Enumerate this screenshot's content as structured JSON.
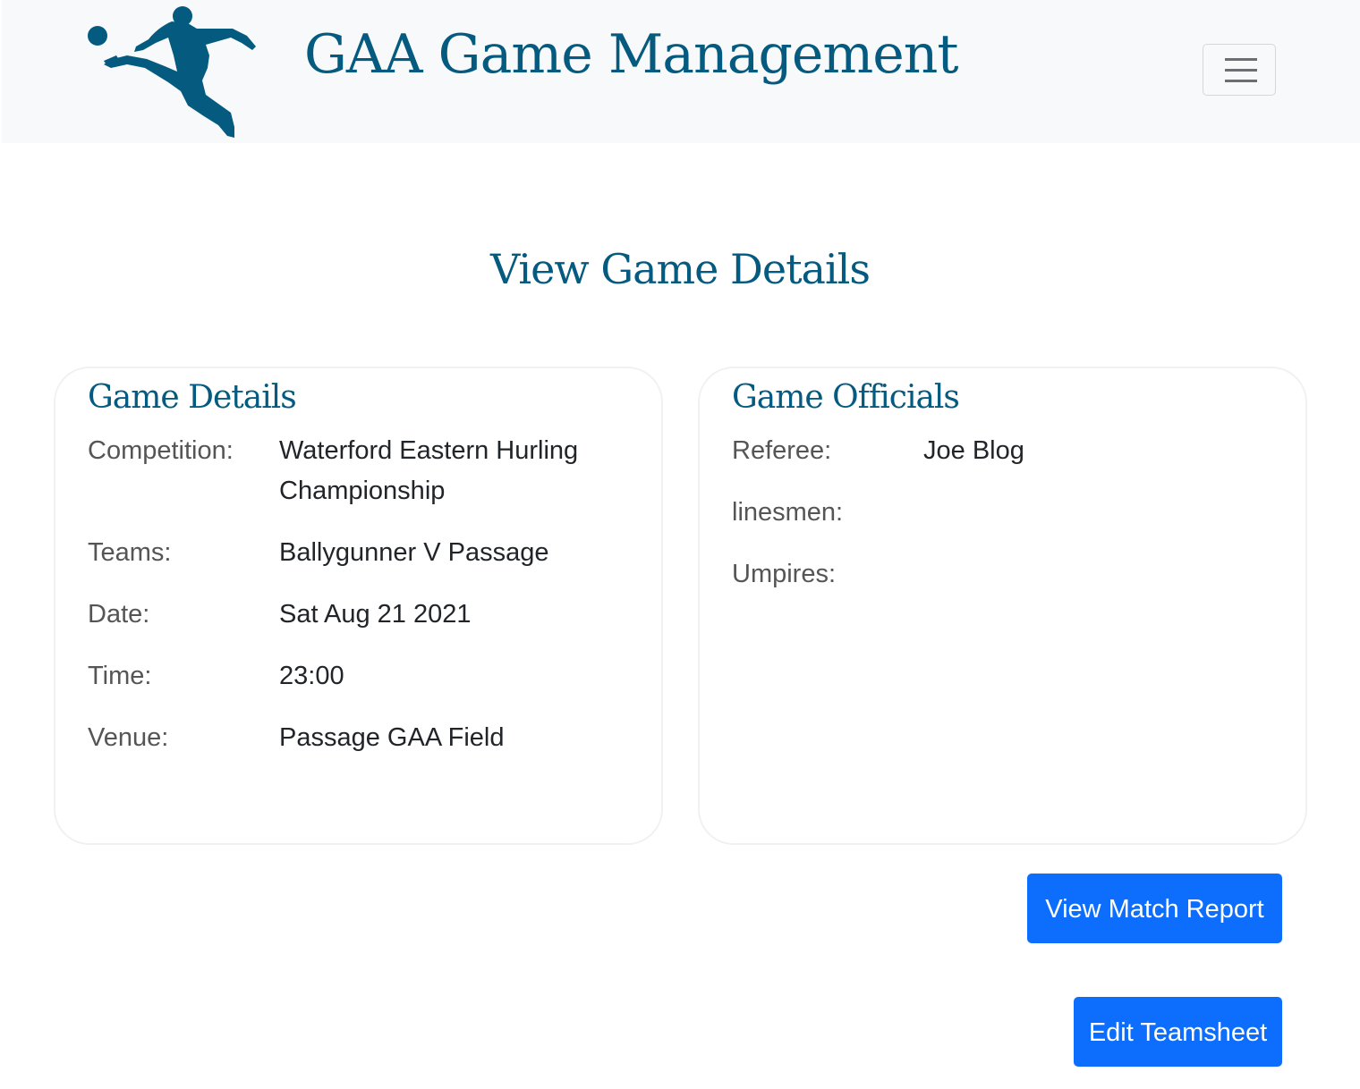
{
  "header": {
    "brand": "GAA Game Management",
    "logo_icon": "footballer-kicking-logo",
    "menu_icon": "hamburger-menu-icon"
  },
  "page_title": "View Game Details",
  "game_details": {
    "title": "Game Details",
    "competition_label": "Competition:",
    "competition_value_line1": "Waterford Eastern Hurling",
    "competition_value_line2": "Championship",
    "teams_label": "Teams:",
    "teams_value": "Ballygunner V Passage",
    "date_label": "Date:",
    "date_value": "Sat Aug 21 2021",
    "time_label": "Time:",
    "time_value": "23:00",
    "venue_label": "Venue:",
    "venue_value": "Passage GAA Field"
  },
  "game_officials": {
    "title": "Game Officials",
    "referee_label": "Referee:",
    "referee_value": "Joe Blog",
    "linesmen_label": "linesmen:",
    "linesmen_value": "",
    "umpires_label": "Umpires:",
    "umpires_value": ""
  },
  "actions": {
    "view_match_report": "View Match Report",
    "edit_teamsheet": "Edit Teamsheet"
  },
  "colors": {
    "brand": "#055a80",
    "primary_button": "#0d6efd",
    "navbar_bg": "#f8f9fa"
  }
}
